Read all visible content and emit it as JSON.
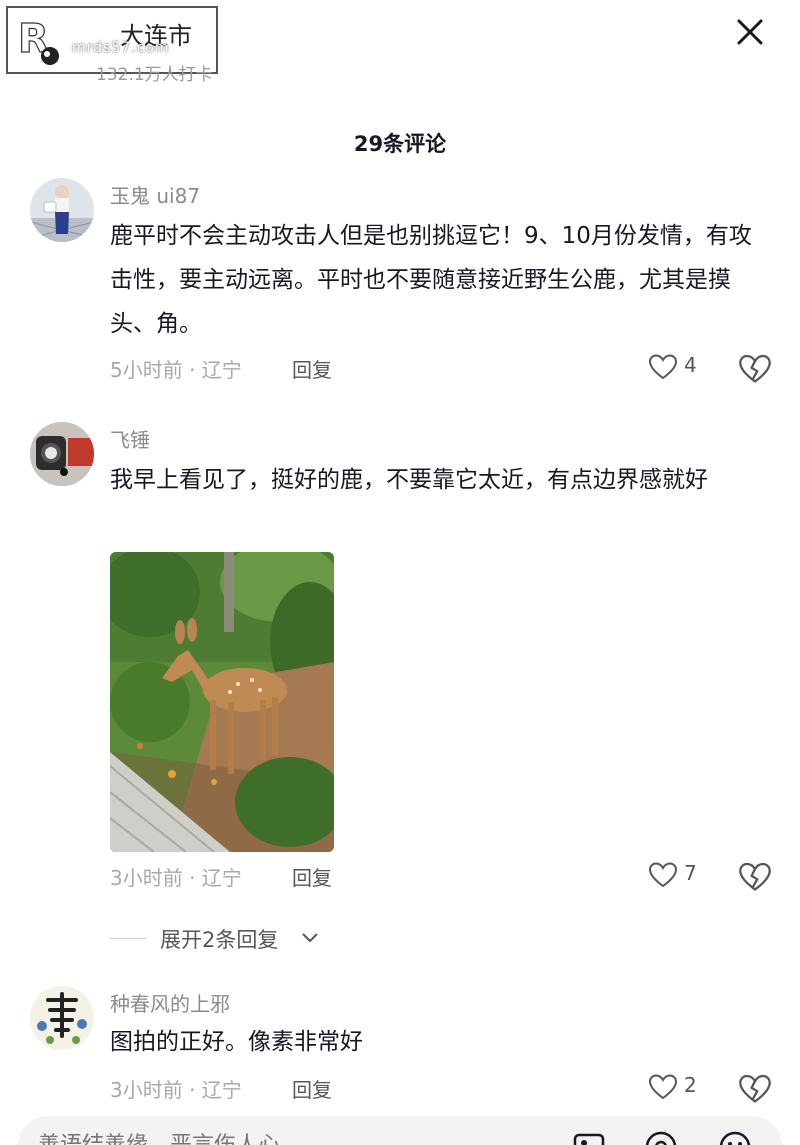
{
  "header": {
    "location_name": "大连市",
    "checkins": "132.1万人打卡",
    "watermark_text": "mrds57.com"
  },
  "comments_header": {
    "count_label": "29条评论"
  },
  "comments": [
    {
      "username": "玉鬼 ui87",
      "text": "鹿平时不会主动攻击人但是也别挑逗它！9、10月份发情，有攻击性，要主动远离。平时也不要随意接近野生公鹿，尤其是摸头、角。",
      "meta": "5小时前 · 辽宁",
      "reply_label": "回复",
      "likes": "4"
    },
    {
      "username": "飞锤",
      "text": "我早上看见了，挺好的鹿，不要靠它太近，有点边界感就好",
      "meta": "3小时前 · 辽宁",
      "reply_label": "回复",
      "likes": "7",
      "expand_label": "展开2条回复"
    },
    {
      "username": "种春风的上邪",
      "text": "图拍的正好。像素非常好",
      "meta": "3小时前 · 辽宁",
      "reply_label": "回复",
      "likes": "2"
    }
  ],
  "input": {
    "placeholder": "善语结善缘，恶言伤人心"
  },
  "icons": {
    "close": "close-icon",
    "like": "heart-icon",
    "dislike": "broken-heart-icon",
    "expand": "chevron-down-icon",
    "image": "image-icon",
    "mention": "at-icon",
    "emoji": "emoji-icon"
  },
  "colors": {
    "text_primary": "#161823",
    "text_secondary": "#8a8b91",
    "meta": "#a7a8ac",
    "input_bg": "#f3f3f4"
  }
}
